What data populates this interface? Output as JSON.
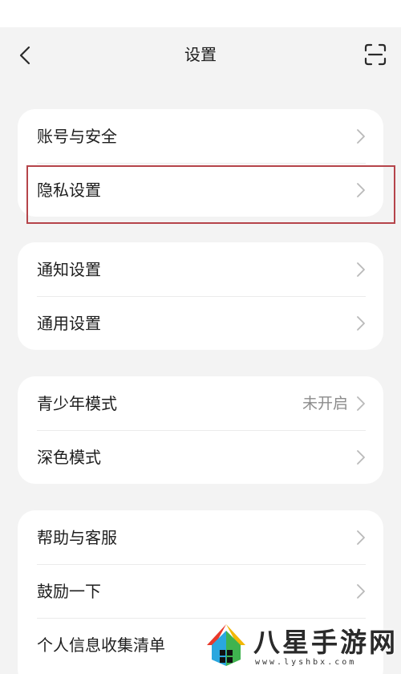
{
  "nav": {
    "title": "设置"
  },
  "groups": [
    {
      "items": [
        {
          "label": "账号与安全"
        },
        {
          "label": "隐私设置"
        }
      ]
    },
    {
      "items": [
        {
          "label": "通知设置"
        },
        {
          "label": "通用设置"
        }
      ]
    },
    {
      "items": [
        {
          "label": "青少年模式",
          "value": "未开启"
        },
        {
          "label": "深色模式"
        }
      ]
    },
    {
      "items": [
        {
          "label": "帮助与客服"
        },
        {
          "label": "鼓励一下"
        },
        {
          "label": "个人信息收集清单"
        }
      ]
    }
  ],
  "colors": {
    "background": "#f3f3f3",
    "card": "#ffffff",
    "highlight_border": "#b5444a",
    "chevron": "#b9b9b9",
    "secondary_text": "#8c8c8c"
  },
  "icons": {
    "back": "chevron-left-icon",
    "scan": "scan-icon",
    "row_arrow": "chevron-right-icon"
  },
  "watermark": {
    "text": "八星手游网",
    "url": "www.lyshbx.com"
  }
}
